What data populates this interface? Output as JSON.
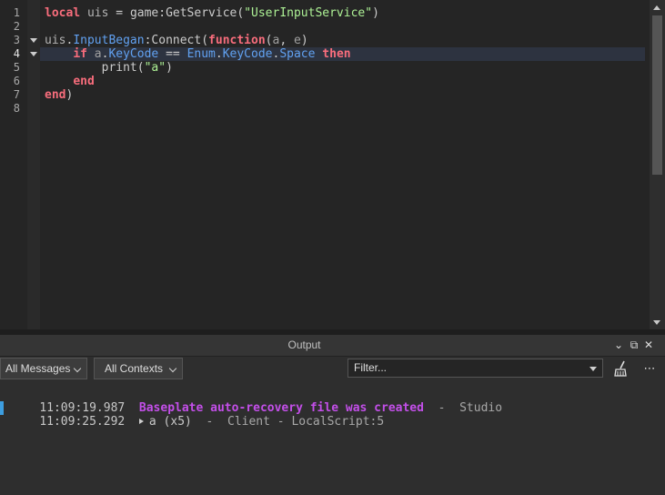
{
  "editor": {
    "line_numbers": [
      "1",
      "2",
      "3",
      "4",
      "5",
      "6",
      "7",
      "8"
    ],
    "active_line": "4",
    "lines": [
      [
        {
          "c": "kw",
          "t": "local"
        },
        {
          "c": "op",
          "t": " "
        },
        {
          "c": "var",
          "t": "uis"
        },
        {
          "c": "op",
          "t": " = "
        },
        {
          "c": "call",
          "t": "game"
        },
        {
          "c": "sep",
          "t": ":"
        },
        {
          "c": "call",
          "t": "GetService"
        },
        {
          "c": "sep",
          "t": "("
        },
        {
          "c": "str",
          "t": "\"UserInputService\""
        },
        {
          "c": "sep",
          "t": ")"
        }
      ],
      [],
      [
        {
          "c": "var",
          "t": "uis"
        },
        {
          "c": "sep",
          "t": "."
        },
        {
          "c": "prop",
          "t": "InputBegan"
        },
        {
          "c": "sep",
          "t": ":"
        },
        {
          "c": "call",
          "t": "Connect"
        },
        {
          "c": "sep",
          "t": "("
        },
        {
          "c": "kw",
          "t": "function"
        },
        {
          "c": "sep",
          "t": "("
        },
        {
          "c": "param",
          "t": "a"
        },
        {
          "c": "sep",
          "t": ", "
        },
        {
          "c": "param",
          "t": "e"
        },
        {
          "c": "sep",
          "t": ")"
        }
      ],
      [
        {
          "c": "op",
          "t": "    "
        },
        {
          "c": "kw",
          "t": "if"
        },
        {
          "c": "op",
          "t": " "
        },
        {
          "c": "param",
          "t": "a"
        },
        {
          "c": "sep",
          "t": "."
        },
        {
          "c": "prop",
          "t": "KeyCode"
        },
        {
          "c": "op",
          "t": " == "
        },
        {
          "c": "prop",
          "t": "Enum"
        },
        {
          "c": "sep",
          "t": "."
        },
        {
          "c": "prop",
          "t": "KeyCode"
        },
        {
          "c": "sep",
          "t": "."
        },
        {
          "c": "prop",
          "t": "Space"
        },
        {
          "c": "op",
          "t": " "
        },
        {
          "c": "kw",
          "t": "then"
        }
      ],
      [
        {
          "c": "op",
          "t": "        "
        },
        {
          "c": "call",
          "t": "print"
        },
        {
          "c": "sep",
          "t": "("
        },
        {
          "c": "str",
          "t": "\"a\""
        },
        {
          "c": "sep",
          "t": ")"
        }
      ],
      [
        {
          "c": "op",
          "t": "    "
        },
        {
          "c": "kw",
          "t": "end"
        }
      ],
      [
        {
          "c": "kw",
          "t": "end"
        },
        {
          "c": "sep",
          "t": ")"
        }
      ],
      []
    ]
  },
  "output": {
    "title": "Output",
    "header_icons": [
      "chevron-down-icon",
      "undock-icon",
      "close-icon"
    ],
    "toolbar": {
      "messages_dropdown": "All Messages",
      "contexts_dropdown": "All Contexts",
      "filter_placeholder": "Filter...",
      "clear_icon": "broom-icon",
      "more_icon": "more-icon"
    },
    "entries": [
      {
        "time": "11:09:19.987",
        "message": "Baseplate auto-recovery file was created",
        "separator": "  -  ",
        "source": "Studio",
        "kind": "warn"
      },
      {
        "time": "11:09:25.292",
        "message": "a (x5)",
        "separator": "  -  ",
        "source": "Client - LocalScript:5",
        "kind": "print"
      }
    ]
  }
}
